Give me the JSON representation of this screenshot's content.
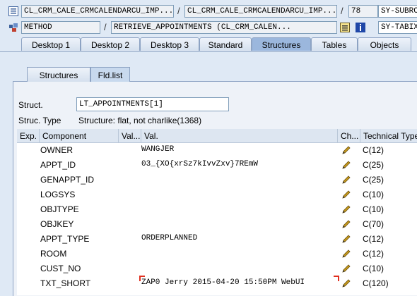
{
  "row1": {
    "field1": "CL_CRM_CALE_CRMCALENDARCU_IMP...",
    "field2": "CL_CRM_CALE_CRMCALENDARCU_IMP...",
    "line": "78",
    "sysfield": "SY-SUBRC"
  },
  "row2": {
    "field1": "METHOD",
    "field2": "RETRIEVE_APPOINTMENTS (CL_CRM_CALEN...",
    "sysfield": "SY-TABIX"
  },
  "tabs": [
    "Desktop 1",
    "Desktop 2",
    "Desktop 3",
    "Standard",
    "Structures",
    "Tables",
    "Objects"
  ],
  "subtabs": [
    "Structures",
    "Fld.list"
  ],
  "struct": {
    "label": "Struct.",
    "value": "LT_APPOINTMENTS[1]",
    "type_label": "Struc. Type",
    "type_value": "Structure: flat, not charlike(1368)"
  },
  "table": {
    "headers": [
      "Exp.",
      "Component",
      "Val...",
      "Val.",
      "Ch...",
      "Technical Type"
    ],
    "rows": [
      {
        "component": "OWNER",
        "value": "WANGJER",
        "type": "C(12)"
      },
      {
        "component": "APPT_ID",
        "value": "03_{XO{xrSz7kIvvZxv}7REmW",
        "type": "C(25)"
      },
      {
        "component": "GENAPPT_ID",
        "value": "",
        "type": "C(25)"
      },
      {
        "component": "LOGSYS",
        "value": "",
        "type": "C(10)"
      },
      {
        "component": "OBJTYPE",
        "value": "",
        "type": "C(10)"
      },
      {
        "component": "OBJKEY",
        "value": "",
        "type": "C(70)"
      },
      {
        "component": "APPT_TYPE",
        "value": "ORDERPLANNED",
        "type": "C(12)"
      },
      {
        "component": "ROOM",
        "value": "",
        "type": "C(12)"
      },
      {
        "component": "CUST_NO",
        "value": "",
        "type": "C(10)"
      },
      {
        "component": "TXT_SHORT",
        "value": "ZAP0 Jerry 2015-04-20 15:50PM WebUI",
        "type": "C(120)"
      }
    ]
  },
  "icons": {
    "row1_icon": "list-icon",
    "row2_icon": "method-icon",
    "row2_ext1": "structure-icon",
    "row2_ext2": "info-icon",
    "edit": "pencil-icon"
  },
  "colors": {
    "accent": "#9bb7dd",
    "pencil": "#c79b1d",
    "bracket": "#e03020"
  }
}
